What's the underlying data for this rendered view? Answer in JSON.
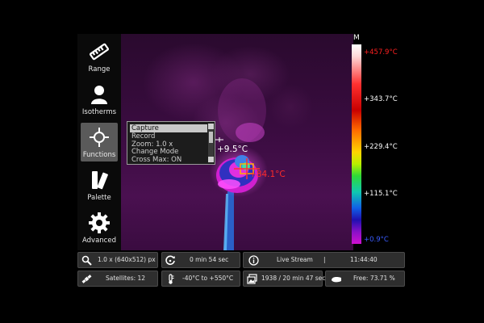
{
  "sidebar": {
    "items": [
      {
        "label": "Range",
        "icon": "ruler-icon"
      },
      {
        "label": "Isotherms",
        "icon": "person-icon"
      },
      {
        "label": "Functions",
        "icon": "crosshair-icon"
      },
      {
        "label": "Palette",
        "icon": "palette-icon"
      },
      {
        "label": "Advanced",
        "icon": "gear-icon"
      }
    ]
  },
  "menu": {
    "items": [
      "Capture",
      "Record",
      "Zoom: 1.0 x",
      "Change Mode",
      "Cross Max: ON"
    ],
    "selected_index": 0
  },
  "overlay": {
    "spot_temp": "+9.5°C",
    "max_temp": "+84.1°C"
  },
  "scale": {
    "marker": "M",
    "labels": [
      "+457.9°C",
      "+343.7°C",
      "+229.4°C",
      "+115.1°C",
      "+0.9°C"
    ],
    "colors": {
      "top": "#ff2020",
      "mid": "#ffffff",
      "bottom": "#3a5cff"
    }
  },
  "status": {
    "zoom": "1.0 x (640x512) px",
    "elapsed": "0 min 54 sec",
    "mode": "Live Stream",
    "separator": "|",
    "clock": "11:44:40",
    "satellites": "Satellites: 12",
    "range": "-40°C to +550°C",
    "frames": "1938 / 20 min 47 sec",
    "free": "Free: 73.71 %"
  },
  "colors": {
    "background": "#000000",
    "panel": "#2e2e2e",
    "active_button": "#5a5a5a",
    "max_text": "#ff2a2a"
  }
}
